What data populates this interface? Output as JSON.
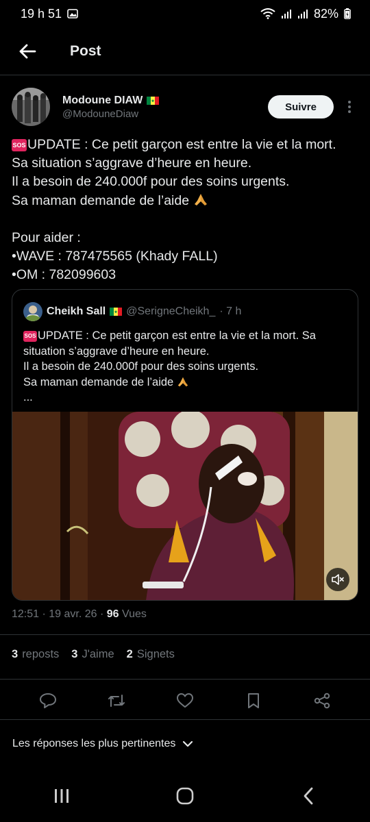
{
  "status": {
    "time": "19 h 51",
    "battery": "82%"
  },
  "header": {
    "title": "Post"
  },
  "author": {
    "name": "Modoune DIAW",
    "handle": "@ModouneDiaw",
    "follow_label": "Suivre"
  },
  "post": {
    "lines": [
      "UPDATE : Ce petit garçon est entre la vie et la mort.",
      "Sa situation s’aggrave d’heure en heure.",
      "Il a besoin de 240.000f pour des soins urgents.",
      "Sa maman demande de l’aide",
      "",
      "Pour aider :",
      "•WAVE : 787475565 (Khady FALL)",
      "•OM : 782099603"
    ]
  },
  "quote": {
    "name": "Cheikh Sall",
    "handle": "@SerigneCheikh_",
    "time": "· 7 h",
    "lines": [
      "UPDATE : Ce petit garçon est entre la vie et la mort. Sa",
      "situation s’aggrave d’heure en heure.",
      "Il a besoin de 240.000f pour des soins urgents.",
      "Sa maman demande de l’aide",
      "..."
    ]
  },
  "meta": {
    "datetime": "12:51 · 19 avr. 26 · ",
    "views_count": "96",
    "views_label": " Vues"
  },
  "stats": [
    {
      "count": "3",
      "label": "reposts"
    },
    {
      "count": "3",
      "label": "J'aime"
    },
    {
      "count": "2",
      "label": "Signets"
    }
  ],
  "replies": {
    "sort_label": "Les réponses les plus pertinentes"
  },
  "icons": {
    "back": "arrow-left-icon",
    "more": "more-vertical-icon",
    "mute": "muted-speaker-icon",
    "reply": "reply-icon",
    "repost": "repost-icon",
    "like": "heart-icon",
    "bookmark": "bookmark-icon",
    "share": "share-icon"
  },
  "colors": {
    "accent": "#1d9bf0",
    "background": "#000000",
    "text": "#e7e9ea",
    "muted": "#71767b",
    "border": "#2f3336"
  }
}
